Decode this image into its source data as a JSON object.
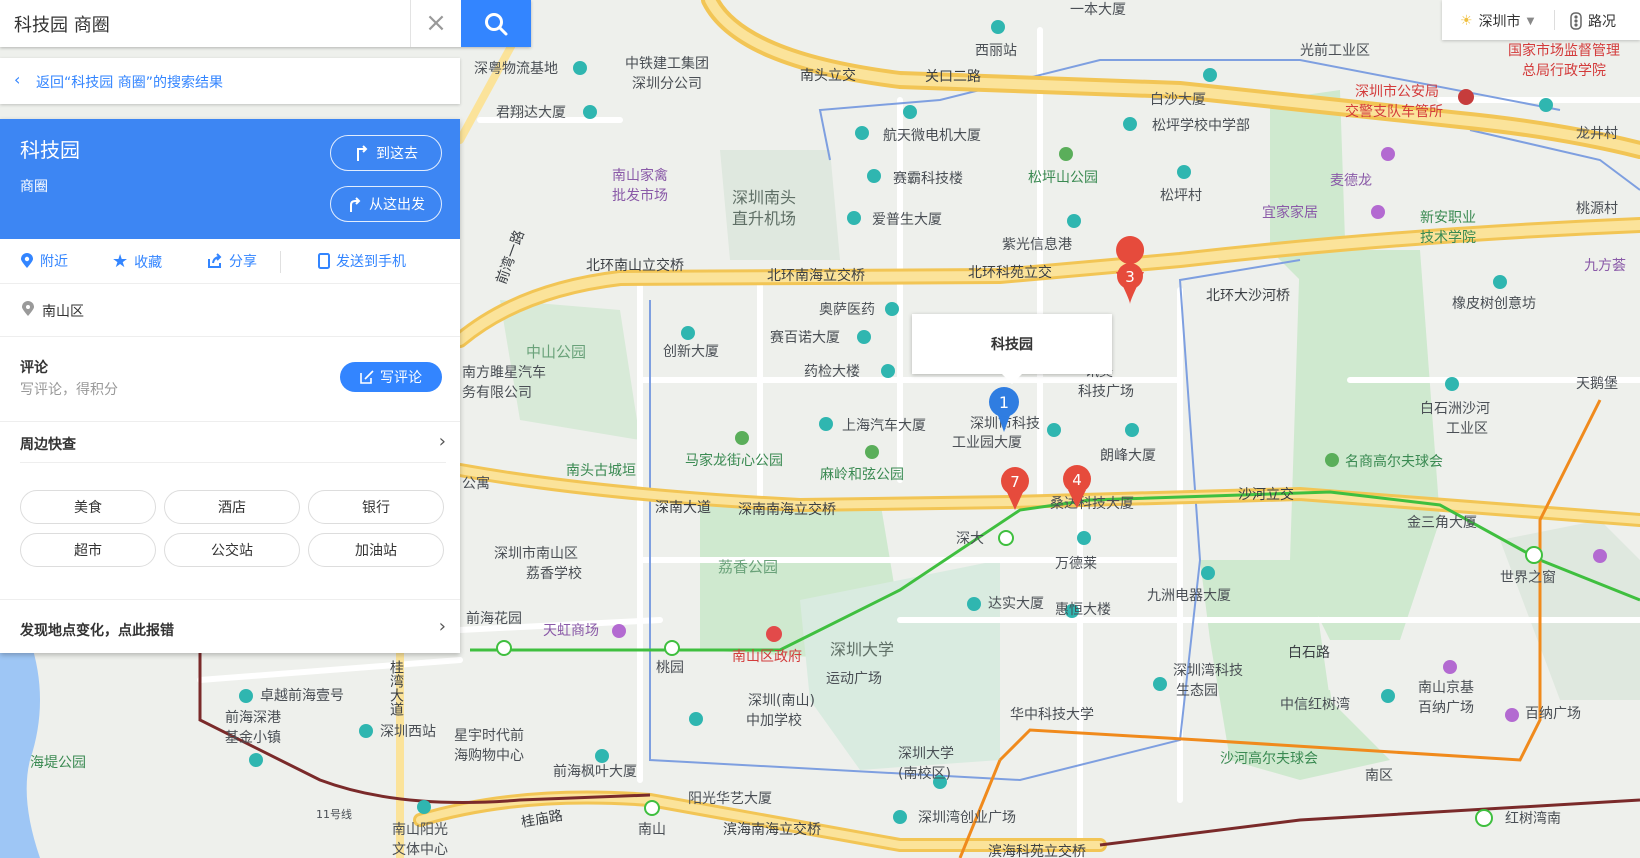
{
  "search": {
    "query": "科技园 商圈"
  },
  "back_link": {
    "label": "返回“科技园 商圈”的搜索结果"
  },
  "place": {
    "name": "科技园",
    "category": "商圈",
    "go_here": "到这去",
    "start_here": "从这出发",
    "actions": [
      "附近",
      "收藏",
      "分享",
      "发送到手机"
    ],
    "district": "南山区",
    "review_title": "评论",
    "review_hint": "写评论，得积分",
    "review_button": "写评论",
    "nearby_title": "周边快查",
    "nearby_tags": [
      "美食",
      "酒店",
      "银行",
      "超市",
      "公交站",
      "加油站"
    ],
    "report": "发现地点变化，点此报错"
  },
  "controls": {
    "city": "深圳市",
    "traffic": "路况"
  },
  "infobox": {
    "title": "科技园"
  },
  "markers": [
    "1",
    "3",
    "4",
    "7"
  ],
  "map_labels": {
    "roads": [
      "关口二路",
      "北环南山立交桥",
      "北环南海立交桥",
      "北环科苑立交",
      "北环大沙河桥",
      "深南大道",
      "深南南海立交桥",
      "沙河立交",
      "白石路",
      "桂庙路",
      "滨海南海立交桥",
      "滨海科苑立交桥",
      "南头立交",
      "前湾一路",
      "桂湾大道"
    ],
    "places": [
      "深粤物流基地",
      "中铁建工集团",
      "深圳分公司",
      "西丽站",
      "一本大厦",
      "光前工业区",
      "君翔达大厦",
      "航天微电机大厦",
      "赛霸科技楼",
      "松坪山公园",
      "松坪学校中学部",
      "白沙大厦",
      "松坪村",
      "南山家禽",
      "批发市场",
      "深圳南头",
      "直升机场",
      "爱普生大厦",
      "紫光信息港",
      "麦德龙",
      "宜家家居",
      "新安职业",
      "技术学院",
      "国家市场监督管理",
      "总局行政学院",
      "深圳市公安局",
      "交警支队车管所",
      "龙井村",
      "桃源村",
      "九方荟",
      "奥萨医药",
      "创新大厦",
      "赛百诺大厦",
      "中山公园",
      "南方雎星汽车",
      "务有限公司",
      "药检大楼",
      "讯美",
      "科技广场",
      "上海汽车大厦",
      "深圳市科技",
      "工业园大厦",
      "朗峰大厦",
      "马家龙街心公园",
      "南头古城垣",
      "麻岭和弦公园",
      "桑达科技大厦",
      "深大",
      "万德莱",
      "名商高尔夫球会",
      "金三角大厦",
      "世界之窗",
      "橡皮树创意坊",
      "白石洲沙河",
      "工业区",
      "天鹅堡",
      "荔香公园",
      "深圳市南山区",
      "荔香学校",
      "达实大厦",
      "惠恒大楼",
      "九洲电器大厦",
      "前海花园",
      "天虹商场",
      "南山区政府",
      "桃园",
      "深圳大学",
      "运动广场",
      "深圳(南山)",
      "中加学校",
      "华中科技大学",
      "深圳湾科技",
      "生态园",
      "中信红树湾",
      "南山京基",
      "百纳广场",
      "百纳广场",
      "卓越前海壹号",
      "前海深港",
      "基金小镇",
      "深圳西站",
      "星宇时代前",
      "海购物中心",
      "海堤公园",
      "前海枫叶大厦",
      "阳光华艺大厦",
      "深圳大学",
      "(南校区)",
      "深圳湾创业广场",
      "沙河高尔夫球会",
      "南山阳光",
      "文体中心",
      "南山",
      "南区",
      "红树湾南",
      "11号线",
      "公寓"
    ]
  }
}
